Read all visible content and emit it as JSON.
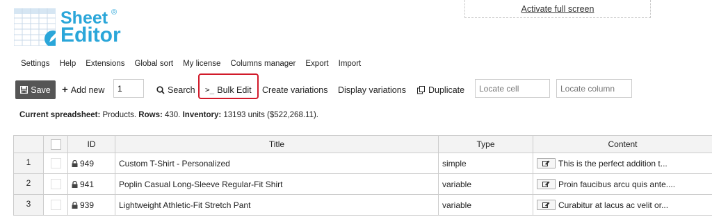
{
  "logo": {
    "line1": "Sheet",
    "line2": "Editor",
    "reg": "®"
  },
  "fullscreen_link": "Activate full screen",
  "menu": [
    "Settings",
    "Help",
    "Extensions",
    "Global sort",
    "My license",
    "Columns manager",
    "Export",
    "Import"
  ],
  "toolbar": {
    "save": "Save",
    "add_new": "Add new",
    "add_count": "1",
    "search": "Search",
    "bulk_edit": "Bulk Edit",
    "create_variations": "Create variations",
    "display_variations": "Display variations",
    "duplicate": "Duplicate",
    "locate_cell_placeholder": "Locate cell",
    "locate_column_placeholder": "Locate column"
  },
  "info": {
    "label_sheet": "Current spreadsheet:",
    "sheet": "Products.",
    "label_rows": "Rows:",
    "rows": "430.",
    "label_inventory": "Inventory:",
    "inventory": "13193 units ($522,268.11)."
  },
  "table": {
    "columns": [
      "ID",
      "Title",
      "Type",
      "Content"
    ],
    "rows": [
      {
        "num": "1",
        "id": "949",
        "title": "Custom T-Shirt - Personalized",
        "type": "simple",
        "content": "This is the perfect addition t..."
      },
      {
        "num": "2",
        "id": "941",
        "title": "Poplin Casual Long-Sleeve Regular-Fit Shirt",
        "type": "variable",
        "content": "Proin faucibus arcu quis ante...."
      },
      {
        "num": "3",
        "id": "939",
        "title": "Lightweight Athletic-Fit Stretch Pant",
        "type": "variable",
        "content": "Curabitur at lacus ac velit or..."
      }
    ]
  },
  "colors": {
    "brand": "#2aa6d9",
    "highlight": "#d11a2a",
    "save_bg": "#555555"
  },
  "icons": [
    "save-icon",
    "plus-icon",
    "search-icon",
    "terminal-icon",
    "duplicate-icon",
    "lock-icon",
    "edit-icon"
  ]
}
